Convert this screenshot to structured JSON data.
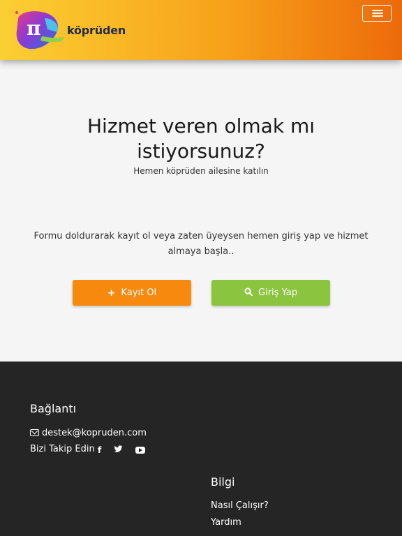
{
  "header": {
    "logo_text": "köprüden",
    "logo_symbol": "π",
    "menu_icon": "hamburger-icon"
  },
  "hero": {
    "title": "Hizmet veren olmak mı istiyorsunuz?",
    "subtitle": "Hemen köprüden ailesine katılın",
    "description": "Formu doldurarak kayıt ol veya zaten üyeysen hemen giriş yap ve hizmet almaya başla..",
    "register_button": {
      "icon": "plus-icon",
      "glyph": "+",
      "label": "Kayıt Ol"
    },
    "login_button": {
      "icon": "search-icon",
      "glyph": "⚲",
      "label": "Giriş Yap"
    }
  },
  "footer": {
    "links_heading": "Bağlantı",
    "email": "destek@kopruden.com",
    "follow_text": "Bizi Takip Edin",
    "social": [
      "facebook-icon",
      "twitter-icon",
      "youtube-icon"
    ],
    "info_heading": "Bilgi",
    "info_links": [
      "Nasıl Çalışır?",
      "Yardım"
    ]
  },
  "colors": {
    "header_gradient": [
      "#fbcf33",
      "#ec6a0a"
    ],
    "register_button": "#f7890f",
    "login_button": "#8bc43f",
    "footer_bg": "#252525"
  }
}
